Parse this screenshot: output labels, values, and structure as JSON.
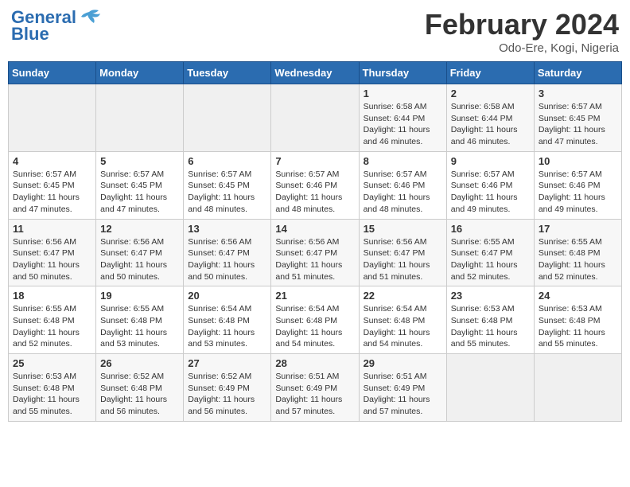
{
  "header": {
    "logo_general": "General",
    "logo_blue": "Blue",
    "month_title": "February 2024",
    "location": "Odo-Ere, Kogi, Nigeria"
  },
  "days_of_week": [
    "Sunday",
    "Monday",
    "Tuesday",
    "Wednesday",
    "Thursday",
    "Friday",
    "Saturday"
  ],
  "weeks": [
    [
      {
        "day": "",
        "sunrise": "",
        "sunset": "",
        "daylight": ""
      },
      {
        "day": "",
        "sunrise": "",
        "sunset": "",
        "daylight": ""
      },
      {
        "day": "",
        "sunrise": "",
        "sunset": "",
        "daylight": ""
      },
      {
        "day": "",
        "sunrise": "",
        "sunset": "",
        "daylight": ""
      },
      {
        "day": "1",
        "sunrise": "6:58 AM",
        "sunset": "6:44 PM",
        "daylight": "11 hours and 46 minutes."
      },
      {
        "day": "2",
        "sunrise": "6:58 AM",
        "sunset": "6:44 PM",
        "daylight": "11 hours and 46 minutes."
      },
      {
        "day": "3",
        "sunrise": "6:57 AM",
        "sunset": "6:45 PM",
        "daylight": "11 hours and 47 minutes."
      }
    ],
    [
      {
        "day": "4",
        "sunrise": "6:57 AM",
        "sunset": "6:45 PM",
        "daylight": "11 hours and 47 minutes."
      },
      {
        "day": "5",
        "sunrise": "6:57 AM",
        "sunset": "6:45 PM",
        "daylight": "11 hours and 47 minutes."
      },
      {
        "day": "6",
        "sunrise": "6:57 AM",
        "sunset": "6:45 PM",
        "daylight": "11 hours and 48 minutes."
      },
      {
        "day": "7",
        "sunrise": "6:57 AM",
        "sunset": "6:46 PM",
        "daylight": "11 hours and 48 minutes."
      },
      {
        "day": "8",
        "sunrise": "6:57 AM",
        "sunset": "6:46 PM",
        "daylight": "11 hours and 48 minutes."
      },
      {
        "day": "9",
        "sunrise": "6:57 AM",
        "sunset": "6:46 PM",
        "daylight": "11 hours and 49 minutes."
      },
      {
        "day": "10",
        "sunrise": "6:57 AM",
        "sunset": "6:46 PM",
        "daylight": "11 hours and 49 minutes."
      }
    ],
    [
      {
        "day": "11",
        "sunrise": "6:56 AM",
        "sunset": "6:47 PM",
        "daylight": "11 hours and 50 minutes."
      },
      {
        "day": "12",
        "sunrise": "6:56 AM",
        "sunset": "6:47 PM",
        "daylight": "11 hours and 50 minutes."
      },
      {
        "day": "13",
        "sunrise": "6:56 AM",
        "sunset": "6:47 PM",
        "daylight": "11 hours and 50 minutes."
      },
      {
        "day": "14",
        "sunrise": "6:56 AM",
        "sunset": "6:47 PM",
        "daylight": "11 hours and 51 minutes."
      },
      {
        "day": "15",
        "sunrise": "6:56 AM",
        "sunset": "6:47 PM",
        "daylight": "11 hours and 51 minutes."
      },
      {
        "day": "16",
        "sunrise": "6:55 AM",
        "sunset": "6:47 PM",
        "daylight": "11 hours and 52 minutes."
      },
      {
        "day": "17",
        "sunrise": "6:55 AM",
        "sunset": "6:48 PM",
        "daylight": "11 hours and 52 minutes."
      }
    ],
    [
      {
        "day": "18",
        "sunrise": "6:55 AM",
        "sunset": "6:48 PM",
        "daylight": "11 hours and 52 minutes."
      },
      {
        "day": "19",
        "sunrise": "6:55 AM",
        "sunset": "6:48 PM",
        "daylight": "11 hours and 53 minutes."
      },
      {
        "day": "20",
        "sunrise": "6:54 AM",
        "sunset": "6:48 PM",
        "daylight": "11 hours and 53 minutes."
      },
      {
        "day": "21",
        "sunrise": "6:54 AM",
        "sunset": "6:48 PM",
        "daylight": "11 hours and 54 minutes."
      },
      {
        "day": "22",
        "sunrise": "6:54 AM",
        "sunset": "6:48 PM",
        "daylight": "11 hours and 54 minutes."
      },
      {
        "day": "23",
        "sunrise": "6:53 AM",
        "sunset": "6:48 PM",
        "daylight": "11 hours and 55 minutes."
      },
      {
        "day": "24",
        "sunrise": "6:53 AM",
        "sunset": "6:48 PM",
        "daylight": "11 hours and 55 minutes."
      }
    ],
    [
      {
        "day": "25",
        "sunrise": "6:53 AM",
        "sunset": "6:48 PM",
        "daylight": "11 hours and 55 minutes."
      },
      {
        "day": "26",
        "sunrise": "6:52 AM",
        "sunset": "6:48 PM",
        "daylight": "11 hours and 56 minutes."
      },
      {
        "day": "27",
        "sunrise": "6:52 AM",
        "sunset": "6:49 PM",
        "daylight": "11 hours and 56 minutes."
      },
      {
        "day": "28",
        "sunrise": "6:51 AM",
        "sunset": "6:49 PM",
        "daylight": "11 hours and 57 minutes."
      },
      {
        "day": "29",
        "sunrise": "6:51 AM",
        "sunset": "6:49 PM",
        "daylight": "11 hours and 57 minutes."
      },
      {
        "day": "",
        "sunrise": "",
        "sunset": "",
        "daylight": ""
      },
      {
        "day": "",
        "sunrise": "",
        "sunset": "",
        "daylight": ""
      }
    ]
  ],
  "labels": {
    "sunrise": "Sunrise:",
    "sunset": "Sunset:",
    "daylight": "Daylight:"
  }
}
